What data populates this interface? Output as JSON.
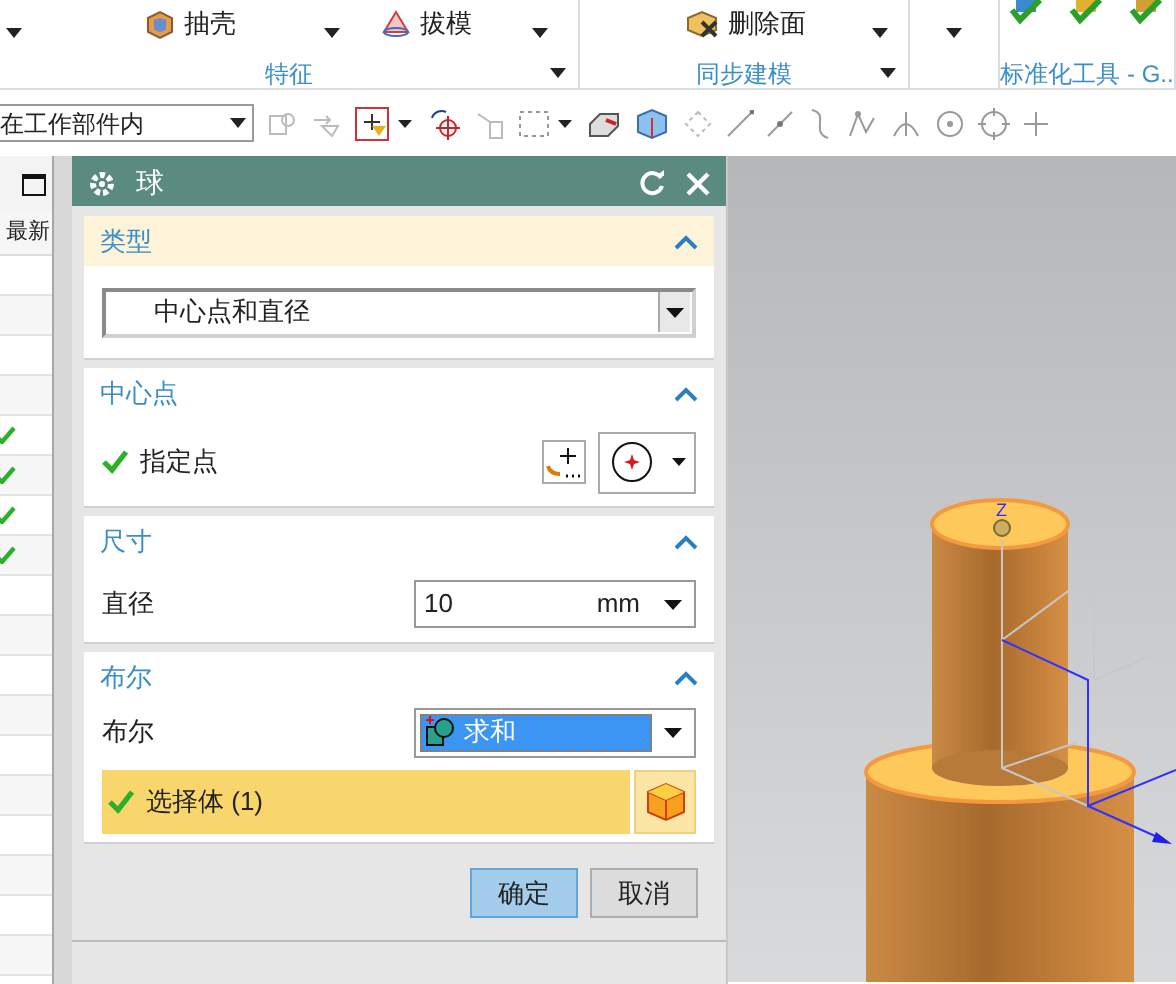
{
  "ribbon": {
    "groups": [
      {
        "label": "特征",
        "has_more": true,
        "commands": [
          {
            "kind": "big",
            "has_menu": true
          },
          {
            "kind": "small",
            "label": "抽壳"
          },
          {
            "kind": "big",
            "has_menu": true
          },
          {
            "kind": "small",
            "label": "拔模"
          },
          {
            "kind": "big",
            "has_menu": true
          }
        ]
      },
      {
        "label": "同步建模",
        "has_more": true,
        "commands": [
          {
            "kind": "small",
            "label": "删除面"
          },
          {
            "kind": "big",
            "has_menu": true
          }
        ]
      },
      {
        "commands": [
          {
            "kind": "big",
            "has_menu": true
          }
        ]
      },
      {
        "label": "标准化工具 - G..",
        "has_more": false,
        "commands": [
          {
            "kind": "icon"
          },
          {
            "kind": "icon"
          },
          {
            "kind": "icon"
          }
        ]
      }
    ]
  },
  "toolbar": {
    "scope": "在工作部件内"
  },
  "left_panel": {
    "column_header": "最新",
    "rows": [
      {
        "checked": false
      },
      {
        "checked": false
      },
      {
        "checked": false
      },
      {
        "checked": false
      },
      {
        "checked": true
      },
      {
        "checked": true
      },
      {
        "checked": true
      },
      {
        "checked": true
      },
      {
        "checked": false
      },
      {
        "checked": false
      },
      {
        "checked": false
      },
      {
        "checked": false
      },
      {
        "checked": false
      },
      {
        "checked": false
      },
      {
        "checked": false
      },
      {
        "checked": false
      },
      {
        "checked": false
      },
      {
        "checked": false
      }
    ]
  },
  "dialog": {
    "title": "球",
    "sections": [
      {
        "kind": "type",
        "title": "类型",
        "highlighted": true,
        "expanded": true,
        "value": "中心点和直径"
      },
      {
        "kind": "point",
        "title": "中心点",
        "highlighted": false,
        "expanded": true,
        "label": "指定点",
        "done": true
      },
      {
        "kind": "dimension",
        "title": "尺寸",
        "highlighted": false,
        "expanded": true,
        "label": "直径",
        "value": "10",
        "unit": "mm"
      },
      {
        "kind": "boolean",
        "title": "布尔",
        "highlighted": false,
        "expanded": true,
        "label": "布尔",
        "value": "求和",
        "select_label": "选择体 (1)",
        "done": true,
        "active": true
      }
    ],
    "buttons": [
      {
        "label": "确定",
        "default": true
      },
      {
        "label": "取消",
        "default": false
      }
    ]
  },
  "viewport": {
    "axis_labels": [
      "Z"
    ]
  }
}
